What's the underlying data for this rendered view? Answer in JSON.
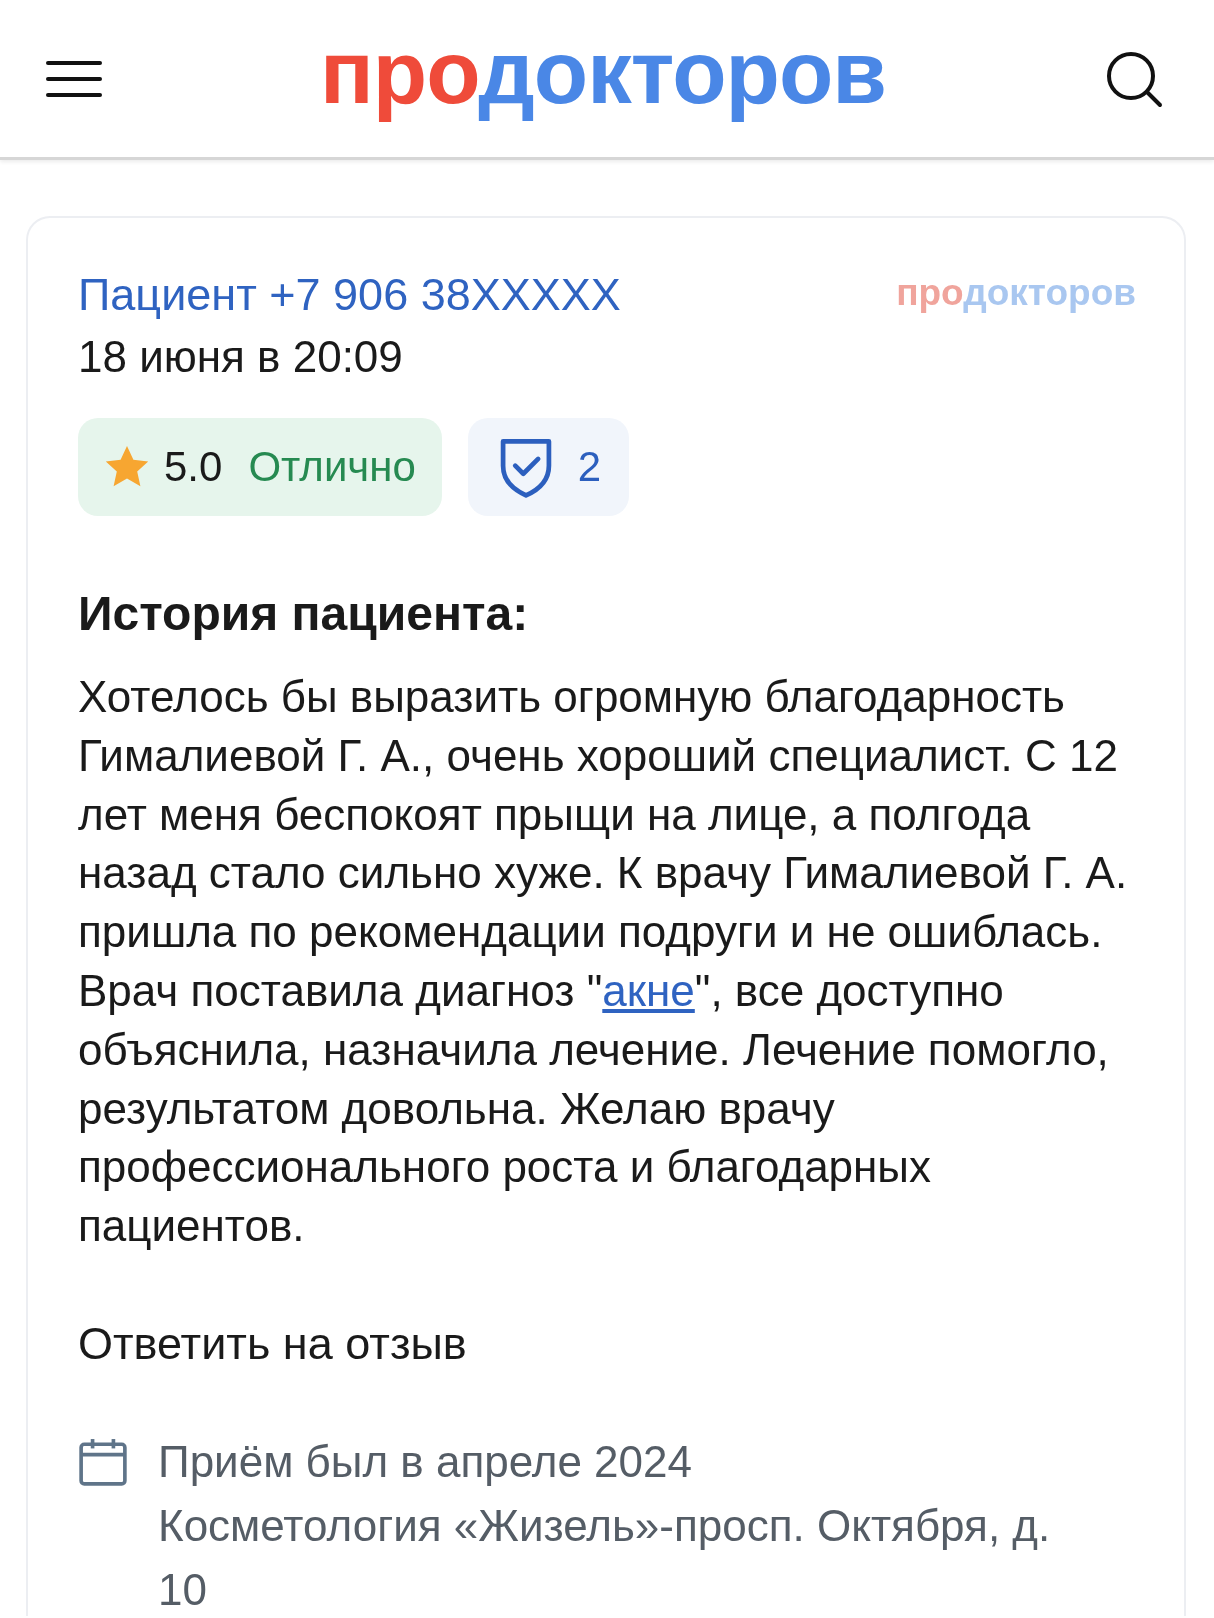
{
  "header": {
    "logo": [
      {
        "text": "про",
        "color": "#ef4b3a"
      },
      {
        "text": "докторов",
        "color": "#4a87e6"
      }
    ]
  },
  "review": {
    "author": "Пациент +7 906 38XXXXX",
    "date": "18 июня в 20:09",
    "watermark_logo": [
      {
        "text": "про",
        "color": "#f0a49c"
      },
      {
        "text": "докторов",
        "color": "#a9c7f0"
      }
    ],
    "rating": {
      "score": "5.0",
      "verdict": "Отлично"
    },
    "verified_count": "2",
    "story_title": "История пациента:",
    "story": [
      {
        "kind": "text",
        "text": "Хотелось бы выразить огромную благодарность Гималиевой Г. А., очень хороший специалист. С 12 лет меня беспокоят прыщи на лице, а полгода назад стало сильно хуже. К врачу Гималиевой Г. А. пришла по рекомендации подруги и не ошиблась. Врач поставила диагноз \""
      },
      {
        "kind": "link",
        "text": "акне"
      },
      {
        "kind": "text",
        "text": "\", все доступно объяснила, назначила лечение. Лечение помогло, результатом довольна. Желаю врачу профессионального роста и благодарных пациентов."
      }
    ],
    "reply_link": "Ответить на отзыв",
    "visit": "Приём был в апреле 2024",
    "clinic": "Косметология «Жизель»-просп. Октября, д. 10"
  }
}
